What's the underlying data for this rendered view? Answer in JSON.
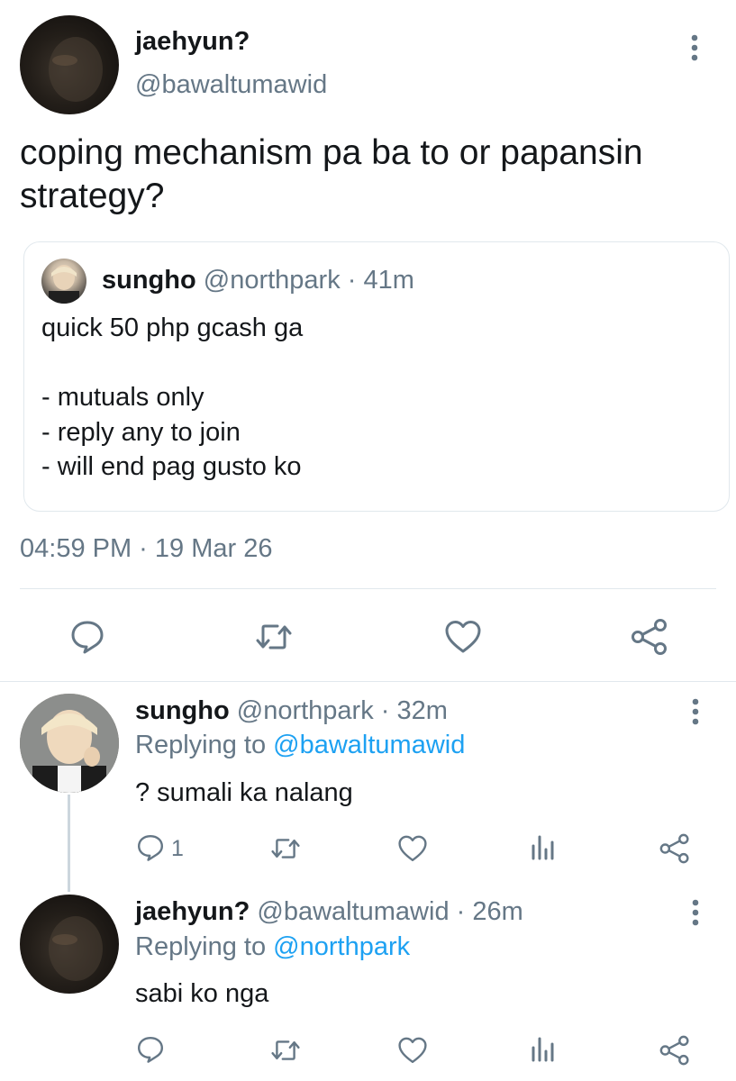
{
  "main_tweet": {
    "display_name": "jaehyun?",
    "handle": "@bawaltumawid",
    "text_line1": "coping mechanism pa ba to or papansin",
    "text_line2": "strategy?",
    "timestamp": "04:59 PM · 19 Mar 26"
  },
  "quoted_tweet": {
    "display_name": "sungho",
    "handle": "@northpark",
    "time": "· 41m",
    "line1": "quick 50 php gcash ga",
    "line2": "- mutuals only",
    "line3": "- reply any to join",
    "line4": "- will end pag gusto ko"
  },
  "replies": [
    {
      "display_name": "sungho",
      "handle": "@northpark",
      "time": "· 32m",
      "replying_prefix": "Replying to",
      "replying_to": "@bawaltumawid",
      "text": "? sumali ka nalang",
      "reply_count": "1"
    },
    {
      "display_name": "jaehyun?",
      "handle": "@bawaltumawid",
      "time": "· 26m",
      "replying_prefix": "Replying to",
      "replying_to": "@northpark",
      "text": "sabi ko nga",
      "reply_count": ""
    }
  ],
  "icons": {
    "more": "more-vertical-icon",
    "reply": "reply-icon",
    "retweet": "retweet-icon",
    "like": "heart-icon",
    "share": "share-icon",
    "analytics": "analytics-icon"
  },
  "colors": {
    "icon": "#657786",
    "link": "#1da1f2",
    "divider": "#e1e8ed"
  }
}
